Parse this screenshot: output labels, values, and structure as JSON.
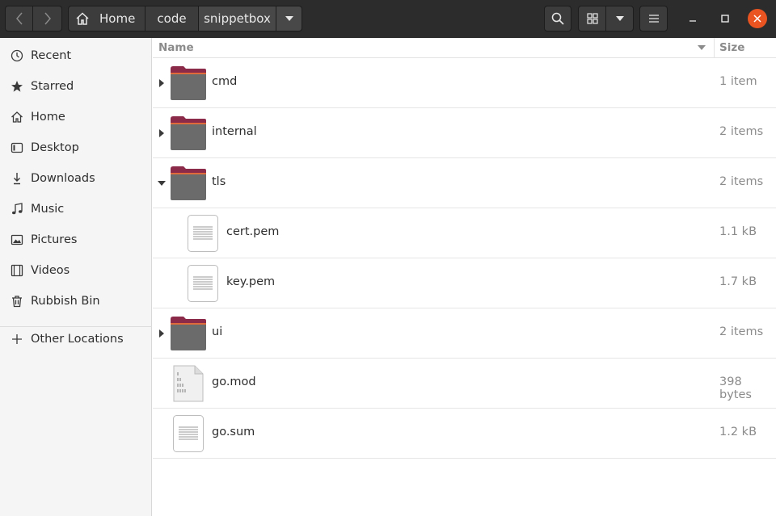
{
  "header": {
    "breadcrumbs": [
      "Home",
      "code",
      "snippetbox"
    ],
    "close_symbol": "✕"
  },
  "sidebar": {
    "items": [
      {
        "label": "Recent",
        "icon": "clock-icon"
      },
      {
        "label": "Starred",
        "icon": "star-icon"
      },
      {
        "label": "Home",
        "icon": "home-icon"
      },
      {
        "label": "Desktop",
        "icon": "desktop-icon"
      },
      {
        "label": "Downloads",
        "icon": "download-icon"
      },
      {
        "label": "Music",
        "icon": "music-icon"
      },
      {
        "label": "Pictures",
        "icon": "pictures-icon"
      },
      {
        "label": "Videos",
        "icon": "videos-icon"
      },
      {
        "label": "Rubbish Bin",
        "icon": "trash-icon"
      },
      {
        "label": "Other Locations",
        "icon": "plus-icon"
      }
    ]
  },
  "columns": {
    "name": "Name",
    "size": "Size"
  },
  "files": [
    {
      "name": "cmd",
      "size": "1 item",
      "type": "folder",
      "expanded": false
    },
    {
      "name": "internal",
      "size": "2 items",
      "type": "folder",
      "expanded": false
    },
    {
      "name": "tls",
      "size": "2 items",
      "type": "folder",
      "expanded": true
    },
    {
      "name": "cert.pem",
      "size": "1.1 kB",
      "type": "text",
      "child": true
    },
    {
      "name": "key.pem",
      "size": "1.7 kB",
      "type": "text",
      "child": true
    },
    {
      "name": "ui",
      "size": "2 items",
      "type": "folder",
      "expanded": false
    },
    {
      "name": "go.mod",
      "size": "398 bytes",
      "type": "binary"
    },
    {
      "name": "go.sum",
      "size": "1.2 kB",
      "type": "text"
    }
  ],
  "colors": {
    "accent": "#e95420",
    "folder_tab": "#8c2a4a",
    "folder_body": "#6b6b6b",
    "header_bg": "#2c2c2c"
  }
}
